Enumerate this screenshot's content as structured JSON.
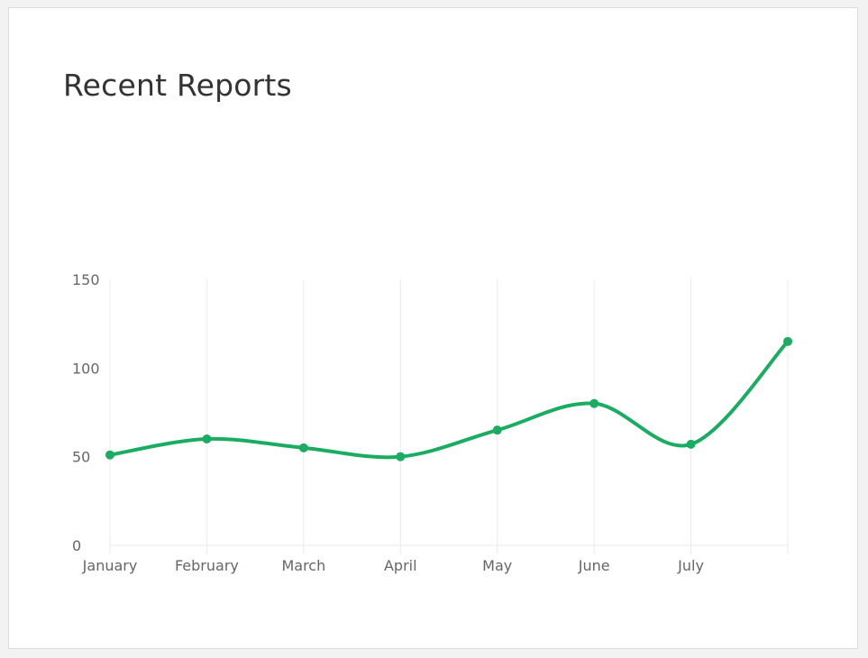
{
  "card": {
    "title": "Recent Reports"
  },
  "colors": {
    "line": "#1aad61",
    "grid": "#ebebeb",
    "tick_text": "#666666"
  },
  "chart_data": {
    "type": "line",
    "title": "Recent Reports",
    "categories": [
      "January",
      "February",
      "March",
      "April",
      "May",
      "June",
      "July",
      ""
    ],
    "series": [
      {
        "values": [
          51,
          60,
          55,
          50,
          65,
          80,
          57,
          115
        ]
      }
    ],
    "ylim": [
      0,
      150
    ],
    "yticks": [
      0,
      50,
      100,
      150
    ],
    "grid": {
      "vertical": true,
      "horizontal": false
    },
    "smooth": true,
    "legend": "none"
  }
}
